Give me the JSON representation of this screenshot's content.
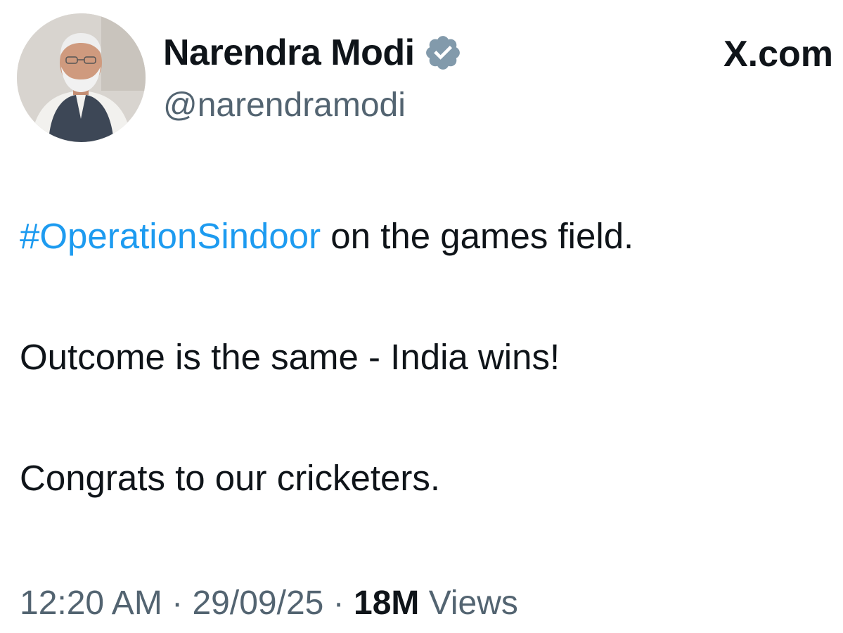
{
  "author": {
    "display_name": "Narendra Modi",
    "handle": "@narendramodi",
    "verified_icon": "verified-badge-icon",
    "verified_color": "#829aab"
  },
  "site_label": "X.com",
  "post": {
    "hashtag": "#OperationSindoor",
    "line1_rest": " on the games field.",
    "line2": "Outcome is the same - India wins!",
    "line3": "Congrats to our cricketers."
  },
  "meta": {
    "time": "12:20 AM",
    "separator": "·",
    "date": "29/09/25",
    "views_count": "18M",
    "views_label": "Views"
  },
  "colors": {
    "text": "#0f1419",
    "secondary": "#536471",
    "hashtag": "#1d9bf0"
  }
}
